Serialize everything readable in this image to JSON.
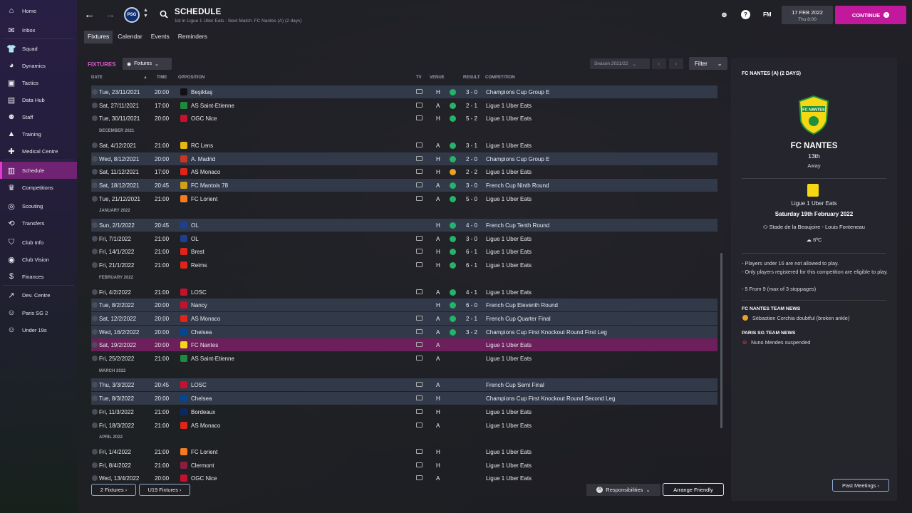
{
  "sidebar": {
    "items": [
      {
        "label": "Home",
        "icon": "home-icon",
        "glyph": "⌂"
      },
      {
        "label": "Inbox",
        "icon": "inbox-icon",
        "glyph": "✉"
      },
      {
        "label": "Squad",
        "icon": "squad-icon",
        "glyph": "👕"
      },
      {
        "label": "Dynamics",
        "icon": "dynamics-icon",
        "glyph": "◕"
      },
      {
        "label": "Tactics",
        "icon": "tactics-icon",
        "glyph": "▣"
      },
      {
        "label": "Data Hub",
        "icon": "data-hub-icon",
        "glyph": "▤"
      },
      {
        "label": "Staff",
        "icon": "staff-icon",
        "glyph": "☻"
      },
      {
        "label": "Training",
        "icon": "training-icon",
        "glyph": "▲"
      },
      {
        "label": "Medical Centre",
        "icon": "medical-icon",
        "glyph": "✚"
      },
      {
        "label": "Schedule",
        "icon": "schedule-icon",
        "glyph": "▥"
      },
      {
        "label": "Competitions",
        "icon": "trophy-icon",
        "glyph": "♛"
      },
      {
        "label": "Scouting",
        "icon": "scouting-icon",
        "glyph": "◎"
      },
      {
        "label": "Transfers",
        "icon": "transfers-icon",
        "glyph": "⟲"
      },
      {
        "label": "Club Info",
        "icon": "club-info-icon",
        "glyph": "⛉"
      },
      {
        "label": "Club Vision",
        "icon": "club-vision-icon",
        "glyph": "◉"
      },
      {
        "label": "Finances",
        "icon": "finances-icon",
        "glyph": "$"
      },
      {
        "label": "Dev. Centre",
        "icon": "dev-centre-icon",
        "glyph": "↗"
      },
      {
        "label": "Paris SG 2",
        "icon": "reserve-team-icon",
        "glyph": "☺"
      },
      {
        "label": "Under 19s",
        "icon": "youth-team-icon",
        "glyph": "☺"
      }
    ]
  },
  "header": {
    "club_badge": "PSG",
    "title": "SCHEDULE",
    "subtitle": "1st in Ligue 1 Uber Eats - Next Match: FC Nantes (A) (2 days)",
    "fm_logo": "FM",
    "date": "17 FEB 2022",
    "time": "Thu 8:00",
    "continue_label": "CONTINUE"
  },
  "tabs": [
    "Fixtures",
    "Calendar",
    "Events",
    "Reminders"
  ],
  "fixtures": {
    "title": "FIXTURES",
    "view_select": "Fixtures",
    "season": "Season 2021/22",
    "filter_label": "Filter",
    "columns": {
      "date": "DATE",
      "time": "TIME",
      "opposition": "OPPOSITION",
      "tv": "TV",
      "venue": "VENUE",
      "result": "RESULT",
      "competition": "COMPETITION"
    },
    "rows": [
      {
        "date": "Tue, 23/11/2021",
        "time": "20:00",
        "opp": "Beşiktaş",
        "tv": true,
        "venue": "H",
        "outcome": "win",
        "result": "3 - 0",
        "comp": "Champions Cup Group E",
        "kind": "cup",
        "crest": "#111111"
      },
      {
        "date": "Sat, 27/11/2021",
        "time": "17:00",
        "opp": "AS Saint-Etienne",
        "tv": true,
        "venue": "A",
        "outcome": "win",
        "result": "2 - 1",
        "comp": "Ligue 1 Uber Eats",
        "kind": "league",
        "crest": "#1e8a3c"
      },
      {
        "date": "Tue, 30/11/2021",
        "time": "20:00",
        "opp": "OGC Nice",
        "tv": true,
        "venue": "H",
        "outcome": "win",
        "result": "5 - 2",
        "comp": "Ligue 1 Uber Eats",
        "kind": "league",
        "crest": "#c8102e"
      },
      {
        "month": "DECEMBER 2021"
      },
      {
        "date": "Sat, 4/12/2021",
        "time": "21:00",
        "opp": "RC Lens",
        "tv": true,
        "venue": "A",
        "outcome": "win",
        "result": "3 - 1",
        "comp": "Ligue 1 Uber Eats",
        "kind": "league",
        "crest": "#e8b70f"
      },
      {
        "date": "Wed, 8/12/2021",
        "time": "20:00",
        "opp": "A. Madrid",
        "tv": true,
        "venue": "H",
        "outcome": "win",
        "result": "2 - 0",
        "comp": "Champions Cup Group E",
        "kind": "cup",
        "crest": "#cb3524"
      },
      {
        "date": "Sat, 11/12/2021",
        "time": "17:00",
        "opp": "AS Monaco",
        "tv": true,
        "venue": "H",
        "outcome": "draw",
        "result": "2 - 2",
        "comp": "Ligue 1 Uber Eats",
        "kind": "league",
        "crest": "#e2231a"
      },
      {
        "date": "Sat, 18/12/2021",
        "time": "20:45",
        "opp": "FC Mantois 78",
        "tv": true,
        "venue": "A",
        "outcome": "win",
        "result": "3 - 0",
        "comp": "French Cup Ninth Round",
        "kind": "cup",
        "crest": "#d4a017"
      },
      {
        "date": "Tue, 21/12/2021",
        "time": "21:00",
        "opp": "FC Lorient",
        "tv": true,
        "venue": "A",
        "outcome": "win",
        "result": "5 - 0",
        "comp": "Ligue 1 Uber Eats",
        "kind": "league",
        "crest": "#f47b20"
      },
      {
        "month": "JANUARY 2022"
      },
      {
        "date": "Sun, 2/1/2022",
        "time": "20:45",
        "opp": "OL",
        "tv": false,
        "venue": "H",
        "outcome": "win",
        "result": "4 - 0",
        "comp": "French Cup Tenth Round",
        "kind": "cup",
        "crest": "#1d3f8f"
      },
      {
        "date": "Fri, 7/1/2022",
        "time": "21:00",
        "opp": "OL",
        "tv": true,
        "venue": "A",
        "outcome": "win",
        "result": "3 - 0",
        "comp": "Ligue 1 Uber Eats",
        "kind": "league",
        "crest": "#1d3f8f"
      },
      {
        "date": "Fri, 14/1/2022",
        "time": "21:00",
        "opp": "Brest",
        "tv": true,
        "venue": "H",
        "outcome": "win",
        "result": "6 - 1",
        "comp": "Ligue 1 Uber Eats",
        "kind": "league",
        "crest": "#e2231a"
      },
      {
        "date": "Fri, 21/1/2022",
        "time": "21:00",
        "opp": "Reims",
        "tv": true,
        "venue": "H",
        "outcome": "win",
        "result": "6 - 1",
        "comp": "Ligue 1 Uber Eats",
        "kind": "league",
        "crest": "#e2231a"
      },
      {
        "month": "FEBRUARY 2022"
      },
      {
        "date": "Fri, 4/2/2022",
        "time": "21:00",
        "opp": "LOSC",
        "tv": true,
        "venue": "A",
        "outcome": "win",
        "result": "4 - 1",
        "comp": "Ligue 1 Uber Eats",
        "kind": "league",
        "crest": "#c8102e"
      },
      {
        "date": "Tue, 8/2/2022",
        "time": "20:00",
        "opp": "Nancy",
        "tv": false,
        "venue": "H",
        "outcome": "win",
        "result": "6 - 0",
        "comp": "French Cup Eleventh Round",
        "kind": "cup",
        "crest": "#c8102e"
      },
      {
        "date": "Sat, 12/2/2022",
        "time": "20:00",
        "opp": "AS Monaco",
        "tv": true,
        "venue": "A",
        "outcome": "win",
        "result": "2 - 1",
        "comp": "French Cup Quarter Final",
        "kind": "cup",
        "crest": "#e2231a"
      },
      {
        "date": "Wed, 16/2/2022",
        "time": "20:00",
        "opp": "Chelsea",
        "tv": true,
        "venue": "A",
        "outcome": "win",
        "result": "3 - 2",
        "comp": "Champions Cup First Knockout Round First Leg",
        "kind": "cup",
        "crest": "#034694"
      },
      {
        "date": "Sat, 19/2/2022",
        "time": "20:00",
        "opp": "FC Nantes",
        "tv": true,
        "venue": "A",
        "outcome": "",
        "result": "",
        "comp": "Ligue 1 Uber Eats",
        "kind": "selected",
        "crest": "#f6d713"
      },
      {
        "date": "Fri, 25/2/2022",
        "time": "21:00",
        "opp": "AS Saint-Etienne",
        "tv": true,
        "venue": "A",
        "outcome": "",
        "result": "",
        "comp": "Ligue 1 Uber Eats",
        "kind": "league",
        "crest": "#1e8a3c"
      },
      {
        "month": "MARCH 2022"
      },
      {
        "date": "Thu, 3/3/2022",
        "time": "20:45",
        "opp": "LOSC",
        "tv": true,
        "venue": "A",
        "outcome": "",
        "result": "",
        "comp": "French Cup Semi Final",
        "kind": "cup",
        "crest": "#c8102e"
      },
      {
        "date": "Tue, 8/3/2022",
        "time": "20:00",
        "opp": "Chelsea",
        "tv": true,
        "venue": "H",
        "outcome": "",
        "result": "",
        "comp": "Champions Cup First Knockout Round Second Leg",
        "kind": "cup",
        "crest": "#034694"
      },
      {
        "date": "Fri, 11/3/2022",
        "time": "21:00",
        "opp": "Bordeaux",
        "tv": true,
        "venue": "H",
        "outcome": "",
        "result": "",
        "comp": "Ligue 1 Uber Eats",
        "kind": "league",
        "crest": "#0b2a5b"
      },
      {
        "date": "Fri, 18/3/2022",
        "time": "21:00",
        "opp": "AS Monaco",
        "tv": true,
        "venue": "A",
        "outcome": "",
        "result": "",
        "comp": "Ligue 1 Uber Eats",
        "kind": "league",
        "crest": "#e2231a"
      },
      {
        "month": "APRIL 2022"
      },
      {
        "date": "Fri, 1/4/2022",
        "time": "21:00",
        "opp": "FC Lorient",
        "tv": true,
        "venue": "H",
        "outcome": "",
        "result": "",
        "comp": "Ligue 1 Uber Eats",
        "kind": "league",
        "crest": "#f47b20"
      },
      {
        "date": "Fri, 8/4/2022",
        "time": "21:00",
        "opp": "Clermont",
        "tv": true,
        "venue": "H",
        "outcome": "",
        "result": "",
        "comp": "Ligue 1 Uber Eats",
        "kind": "league",
        "crest": "#8b1e3f"
      },
      {
        "date": "Wed, 13/4/2022",
        "time": "20:00",
        "opp": "OGC Nice",
        "tv": true,
        "venue": "A",
        "outcome": "",
        "result": "",
        "comp": "Ligue 1 Uber Eats",
        "kind": "league",
        "crest": "#c8102e"
      }
    ],
    "outcome_colors": {
      "win": "#25b36a",
      "draw": "#e8a326"
    },
    "bottom": {
      "fixtures2": "2 Fixtures",
      "u19": "U19 Fixtures",
      "responsibilities": "Responsibilities",
      "arrange": "Arrange Friendly"
    }
  },
  "match_panel": {
    "heading": "FC NANTES (A) (2 DAYS)",
    "crest_text": "FC NANTES",
    "team": "FC NANTES",
    "position": "13th",
    "venue_type": "Away",
    "competition": "Ligue 1 Uber Eats",
    "date": "Saturday 19th February 2022",
    "stadium": "Stade de la Beaujoire - Louis Fonteneau",
    "weather": "6ºC",
    "rules": [
      "- Players under 16 are not allowed to play.",
      "- Only players registered for this competition are eligible to play.",
      "- 5 From 9 (max of 3 stoppages)"
    ],
    "opp_news_title": "FC NANTES TEAM NEWS",
    "opp_news": "Sébastien Corchia doubtful (broken ankle)",
    "own_news_title": "PARIS SG TEAM NEWS",
    "own_news": "Nuno Mendes suspended",
    "past_meetings": "Past Meetings"
  }
}
